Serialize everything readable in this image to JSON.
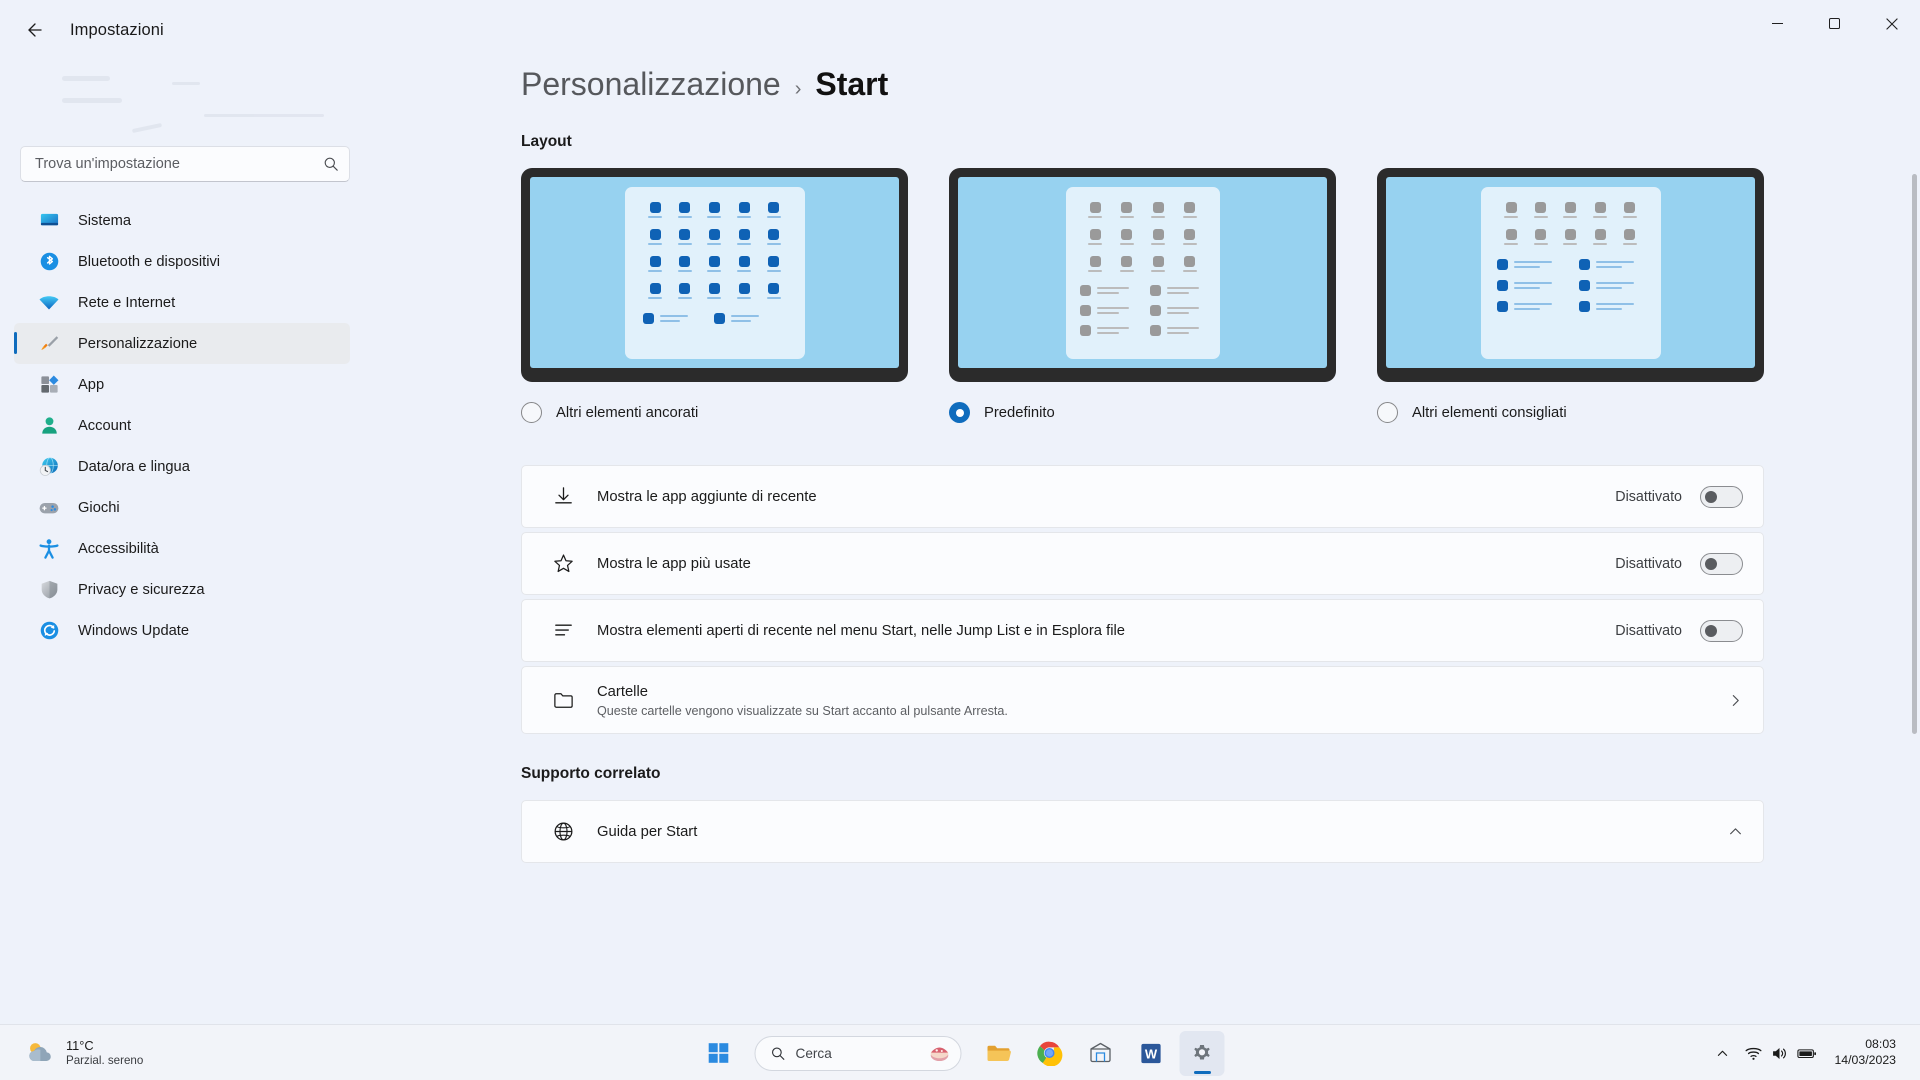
{
  "window": {
    "title": "Impostazioni",
    "back_icon": "arrow-left-icon",
    "minimize_label": "—",
    "maximize_label": "☐",
    "close_label": "✕"
  },
  "sidebar": {
    "search": {
      "placeholder": "Trova un'impostazione",
      "value": "",
      "icon": "search-icon"
    },
    "items": [
      {
        "label": "Sistema",
        "icon": "monitor-icon",
        "selected": false
      },
      {
        "label": "Bluetooth e dispositivi",
        "icon": "bluetooth-icon",
        "selected": false
      },
      {
        "label": "Rete e Internet",
        "icon": "wifi-icon",
        "selected": false
      },
      {
        "label": "Personalizzazione",
        "icon": "paintbrush-icon",
        "selected": true
      },
      {
        "label": "App",
        "icon": "apps-icon",
        "selected": false
      },
      {
        "label": "Account",
        "icon": "person-icon",
        "selected": false
      },
      {
        "label": "Data/ora e lingua",
        "icon": "clock-globe-icon",
        "selected": false
      },
      {
        "label": "Giochi",
        "icon": "gamepad-icon",
        "selected": false
      },
      {
        "label": "Accessibilità",
        "icon": "accessibility-icon",
        "selected": false
      },
      {
        "label": "Privacy e sicurezza",
        "icon": "shield-icon",
        "selected": false
      },
      {
        "label": "Windows Update",
        "icon": "refresh-icon",
        "selected": false
      }
    ]
  },
  "breadcrumb": {
    "parent": "Personalizzazione",
    "separator": "›",
    "current": "Start"
  },
  "layout_section": {
    "title": "Layout",
    "options": [
      {
        "label": "Altri elementi ancorati",
        "selected": false,
        "style": "blue",
        "variant": "more-pinned"
      },
      {
        "label": "Predefinito",
        "selected": true,
        "style": "gray",
        "variant": "default"
      },
      {
        "label": "Altri elementi consigliati",
        "selected": false,
        "style": "blue",
        "variant": "more-recommendations"
      }
    ]
  },
  "settings_rows": [
    {
      "title": "Mostra le app aggiunte di recente",
      "icon": "download-icon",
      "state": "Disattivato",
      "toggle_on": false
    },
    {
      "title": "Mostra le app più usate",
      "icon": "star-icon",
      "state": "Disattivato",
      "toggle_on": false
    },
    {
      "title": "Mostra elementi aperti di recente nel menu Start, nelle Jump List e in Esplora file",
      "icon": "list-icon",
      "state": "Disattivato",
      "toggle_on": false
    }
  ],
  "folders_row": {
    "title": "Cartelle",
    "subtitle": "Queste cartelle vengono visualizzate su Start accanto al pulsante Arresta.",
    "icon": "folder-icon",
    "chevron": "chevron-right-icon"
  },
  "related_support": {
    "title": "Supporto correlato",
    "rows": [
      {
        "title": "Guida per Start",
        "icon": "globe-icon",
        "chevron": "chevron-up-icon"
      }
    ]
  },
  "taskbar": {
    "weather": {
      "temperature": "11°C",
      "description": "Parzial. sereno",
      "icon": "partly-cloudy-icon"
    },
    "start_icon": "windows-start-icon",
    "search": {
      "placeholder": "Cerca",
      "icon": "search-icon"
    },
    "apps": [
      {
        "name": "widgets-icon",
        "active": false
      },
      {
        "name": "file-explorer-icon",
        "active": false
      },
      {
        "name": "chrome-icon",
        "active": false
      },
      {
        "name": "store-icon",
        "active": false
      },
      {
        "name": "word-icon",
        "active": false
      },
      {
        "name": "settings-icon",
        "active": true
      }
    ],
    "tray": {
      "chevron": "chevron-up-icon",
      "wifi": "wifi-icon",
      "volume": "volume-icon",
      "battery": "battery-icon",
      "time": "08:03",
      "date": "14/03/2023"
    }
  },
  "colors": {
    "accent": "#0f6cbd",
    "bg": "#eef2fa",
    "card": "#fbfcfe",
    "bezel": "#2b2b2b",
    "wallpaper": "#97d2f0",
    "panel": "#e1f1fb"
  }
}
